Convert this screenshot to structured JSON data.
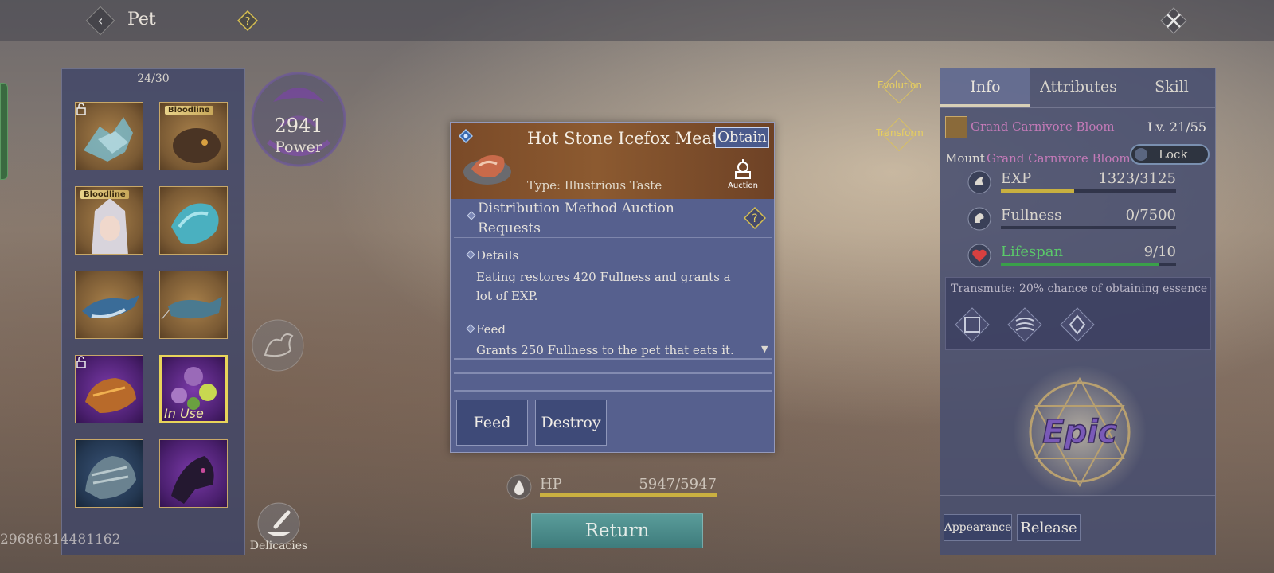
{
  "header": {
    "title": "Pet",
    "back_icon": "back-arrow-icon",
    "help_icon": "help-icon",
    "close_icon": "close-icon"
  },
  "pet_list": {
    "count": "24/30",
    "slots": [
      {
        "name": "ice-dragon",
        "frame": "gold",
        "tag": "",
        "locked": true
      },
      {
        "name": "wolf",
        "frame": "gold",
        "tag": "Bloodline",
        "locked": false
      },
      {
        "name": "elf-girl",
        "frame": "gold",
        "tag": "Bloodline",
        "locked": false
      },
      {
        "name": "water-serpent",
        "frame": "gold",
        "tag": "",
        "locked": false
      },
      {
        "name": "dolphin",
        "frame": "gold",
        "tag": "",
        "locked": false
      },
      {
        "name": "catfish",
        "frame": "gold",
        "tag": "",
        "locked": false
      },
      {
        "name": "fire-dragon",
        "frame": "purple",
        "tag": "",
        "locked": true
      },
      {
        "name": "carnivore-bloom",
        "frame": "purple",
        "tag": "In Use",
        "locked": false
      },
      {
        "name": "armored-beast",
        "frame": "blue",
        "tag": "",
        "locked": false
      },
      {
        "name": "dark-bird",
        "frame": "purple",
        "tag": "",
        "locked": false
      }
    ]
  },
  "account_id": "29686814481162",
  "power": {
    "value": "2941",
    "label": "Power"
  },
  "delicacies": {
    "label": "Delicacies"
  },
  "side_actions": {
    "evolution": "Evolution",
    "transform": "Transform"
  },
  "item_popup": {
    "name": "Hot Stone Icefox Meat",
    "obtain_label": "Obtain",
    "type": "Type: Illustrious Taste",
    "auction_label": "Auction",
    "distribution": "Distribution Method    Auction Requests",
    "details_title": "Details",
    "details_text": "Eating restores 420 Fullness and grants a lot of EXP.",
    "feed_title": "Feed",
    "feed_text": "Grants 250 Fullness to the pet that eats it.",
    "feed_button": "Feed",
    "destroy_button": "Destroy"
  },
  "hp": {
    "label": "HP",
    "value": "5947/5947"
  },
  "return_button": "Return",
  "info_panel": {
    "tabs": [
      "Info",
      "Attributes",
      "Skill"
    ],
    "active_tab": "Info",
    "pet_name": "Grand Carnivore Bloom",
    "level": "Lv. 21/55",
    "mount_label": "Mount",
    "mount_name": "Grand Carnivore Bloom",
    "lock_label": "Lock",
    "stats": [
      {
        "label": "EXP",
        "value": "1323/3125",
        "fraction": 0.42,
        "color": "#c8b040",
        "label_color": "#d8d4cc"
      },
      {
        "label": "Fullness",
        "value": "0/7500",
        "fraction": 0,
        "color": "#c8b040",
        "label_color": "#d8d4cc"
      },
      {
        "label": "Lifespan",
        "value": "9/10",
        "fraction": 0.9,
        "color": "#3aa04a",
        "label_color": "#5ac86a"
      }
    ],
    "transmute": "Transmute: 20% chance of obtaining essence",
    "rarity": "Epic",
    "appearance_button": "Appearance",
    "release_button": "Release"
  },
  "colors": {
    "gold_frame": "#c8a868",
    "selected_frame": "#e8d45a",
    "pet_name": "#c47ab8",
    "epic": "#7a5ab8"
  }
}
